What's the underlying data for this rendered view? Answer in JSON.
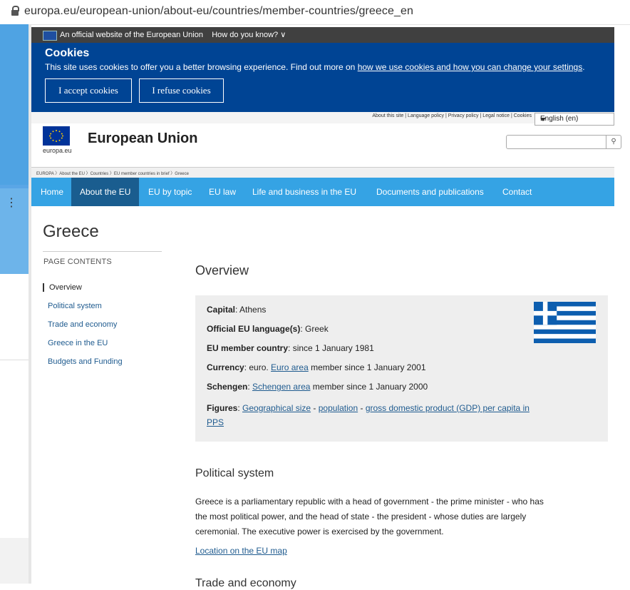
{
  "browser": {
    "url": "europa.eu/european-union/about-eu/countries/member-countries/greece_en"
  },
  "official_banner": {
    "text": "An official website of the European Union",
    "how": "How do you know? ∨"
  },
  "cookie_banner": {
    "title": "Cookies",
    "message_prefix": "This site uses cookies to offer you a better browsing experience. Find out more on ",
    "message_link": "how we use cookies and how you can change your settings",
    "message_suffix": ".",
    "accept_label": "I accept cookies",
    "refuse_label": "I refuse cookies"
  },
  "header": {
    "top_links": "About this site | Language policy | Privacy policy | Legal notice | Cookies",
    "language": "English (en)",
    "site_name": "European Union",
    "logo_caption": "europa.eu",
    "search_icon": "search-icon"
  },
  "breadcrumb": "EUROPA 〉About the EU 〉Countries 〉EU member countries in brief 〉Greece",
  "nav": {
    "items": [
      "Home",
      "About the EU",
      "EU by topic",
      "EU law",
      "Life and business in the EU",
      "Documents and publications",
      "Contact"
    ],
    "active": "About the EU"
  },
  "page": {
    "title": "Greece",
    "contents_label": "PAGE CONTENTS",
    "contents": [
      "Overview",
      "Political system",
      "Trade and economy",
      "Greece in the EU",
      "Budgets and Funding"
    ]
  },
  "overview": {
    "heading": "Overview",
    "capital_label": "Capital",
    "capital_value": ": Athens",
    "lang_label": "Official EU language(s)",
    "lang_value": ": Greek",
    "member_label": "EU member country",
    "member_value": ": since 1 January 1981",
    "currency_label": "Currency",
    "currency_pre": ": euro. ",
    "currency_link": "Euro area",
    "currency_post": " member since 1 January 2001",
    "schengen_label": "Schengen",
    "schengen_pre": ": ",
    "schengen_link": "Schengen area",
    "schengen_post": " member since 1 January 2000",
    "figures_label": "Figures",
    "figures_pre": ": ",
    "fig_link1": "Geographical size",
    "fig_sep1": " - ",
    "fig_link2": "population",
    "fig_sep2": " - ",
    "fig_link3a": "gross domestic product (GDP) per capita in",
    "fig_link3b": "PPS",
    "flag_colors": {
      "blue": "#0d5eaf",
      "white": "#ffffff"
    }
  },
  "political": {
    "heading": "Political system",
    "line1": "Greece is a parliamentary republic with a head of government - the prime minister - who has",
    "line2": "the most political power, and the head of state - the president - whose duties are largely",
    "line3": "ceremonial. The executive power is exercised by the government.",
    "map_link": "Location on the EU map"
  },
  "trade": {
    "heading": "Trade and economy"
  }
}
